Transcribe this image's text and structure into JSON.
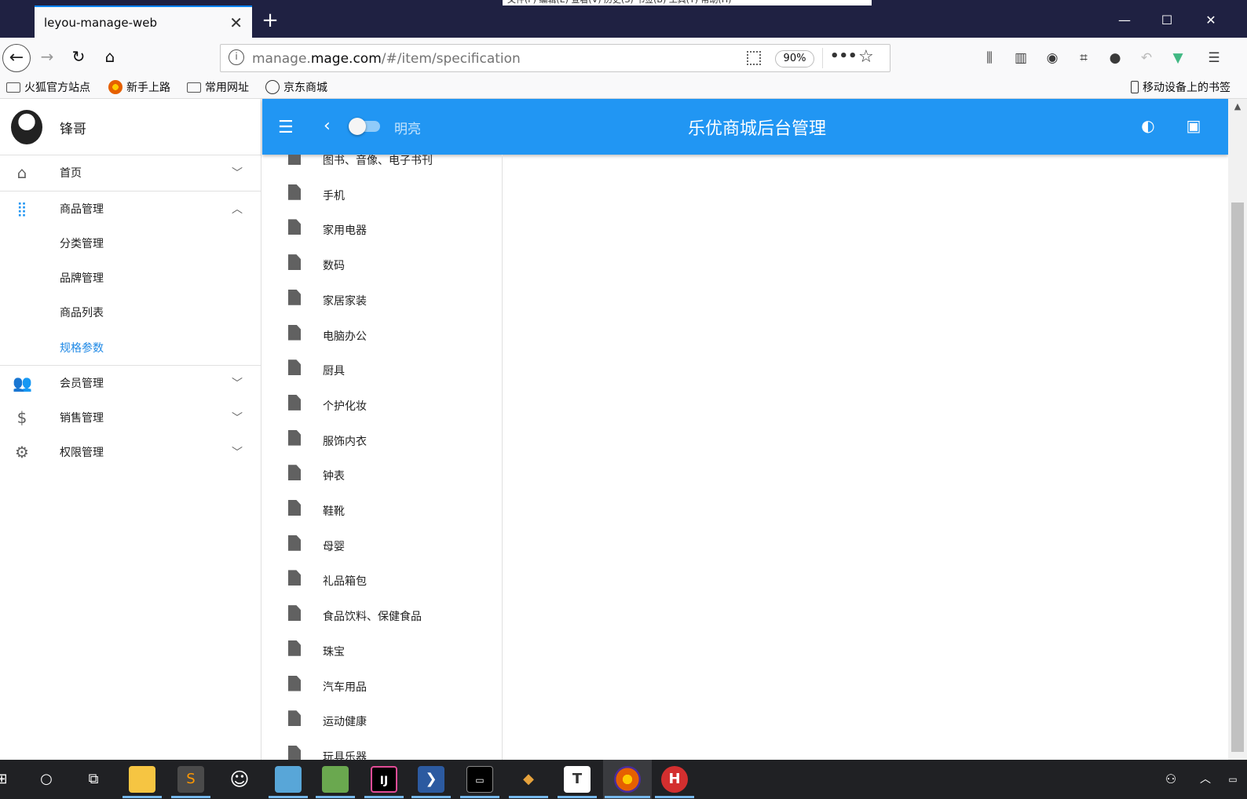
{
  "browser": {
    "tab_title": "leyou-manage-web",
    "url_host": "manage.",
    "url_domain": "mage.com",
    "url_path": "/#/item/specification",
    "zoom": "90%",
    "menu_hint": "文件(F)  编辑(E)  查看(V)  历史(S)  书签(B)  工具(T)  帮助(H)",
    "bookmarks": [
      {
        "label": "火狐官方站点"
      },
      {
        "label": "新手上路"
      },
      {
        "label": "常用网址"
      },
      {
        "label": "京东商城"
      }
    ],
    "mobile_bookmarks": "移动设备上的书签"
  },
  "sidebar": {
    "user_name": "锋哥",
    "items": [
      {
        "label": "首页",
        "icon": "home-icon",
        "expanded": false
      },
      {
        "label": "商品管理",
        "icon": "apps-grid-icon",
        "expanded": true,
        "children": [
          "分类管理",
          "品牌管理",
          "商品列表",
          "规格参数"
        ]
      },
      {
        "label": "会员管理",
        "icon": "people-icon",
        "expanded": false
      },
      {
        "label": "销售管理",
        "icon": "dollar-icon",
        "expanded": false
      },
      {
        "label": "权限管理",
        "icon": "gear-icon",
        "expanded": false
      }
    ],
    "active_child": "规格参数"
  },
  "appbar": {
    "theme_label": "明亮",
    "title": "乐优商城后台管理"
  },
  "tree": {
    "nodes": [
      "图书、音像、电子书刊",
      "手机",
      "家用电器",
      "数码",
      "家居家装",
      "电脑办公",
      "厨具",
      "个护化妆",
      "服饰内衣",
      "钟表",
      "鞋靴",
      "母婴",
      "礼品箱包",
      "食品饮料、保健食品",
      "珠宝",
      "汽车用品",
      "运动健康",
      "玩具乐器"
    ]
  },
  "colors": {
    "primary": "#2196f3",
    "active": "#1e88e5"
  }
}
